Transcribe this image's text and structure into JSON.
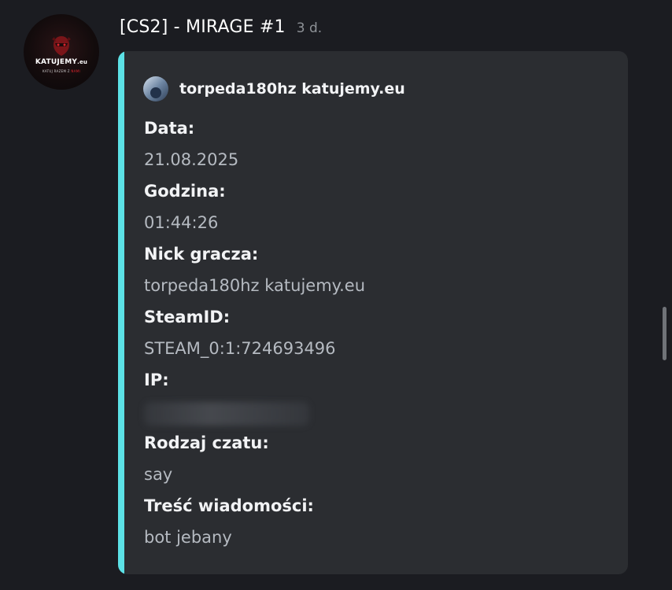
{
  "message": {
    "author": "[CS2] - MIRAGE #1",
    "timestamp": "3 d.",
    "avatar": {
      "logo_main": "KATUJEMY",
      "logo_suffix": ".eu",
      "logo_sub_prefix": "KATUJ RAZEM Z",
      "logo_sub_accent": "NAMI"
    }
  },
  "embed": {
    "accent_color": "#5ce1e6",
    "author_name": "torpeda180hz katujemy.eu",
    "fields": [
      {
        "name": "Data:",
        "value": "21.08.2025"
      },
      {
        "name": "Godzina:",
        "value": "01:44:26"
      },
      {
        "name": "Nick gracza:",
        "value": "torpeda180hz katujemy.eu"
      },
      {
        "name": "SteamID:",
        "value": "STEAM_0:1:724693496"
      },
      {
        "name": "IP:",
        "value": ""
      },
      {
        "name": "Rodzaj czatu:",
        "value": "say"
      },
      {
        "name": "Treść wiadomości:",
        "value": "bot jebany"
      }
    ]
  }
}
